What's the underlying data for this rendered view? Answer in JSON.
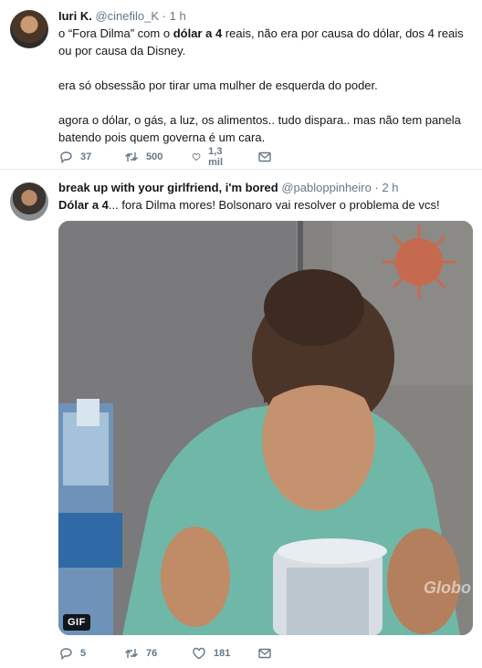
{
  "tweets": [
    {
      "name": "Iuri K.",
      "handle": "@cinefilo_K",
      "dot": "·",
      "time": "1 h",
      "lines": {
        "p1_a": "o “Fora Dilma” com o ",
        "p1_b": "dólar a 4",
        "p1_c": " reais, não era por causa do dólar, dos 4 reais ou por causa da Disney.",
        "p2": "era só obsessão por tirar uma mulher de esquerda do poder.",
        "p3": "agora o dólar, o gás, a luz, os alimentos.. tudo dispara.. mas não tem panela batendo pois quem governa é um cara."
      },
      "replies": "37",
      "retweets": "500",
      "likes": "1,3 mil"
    },
    {
      "name": "break up with your girlfriend, i'm bored",
      "handle": "@pabloppinheiro",
      "dot": "·",
      "time": "2 h",
      "lines": {
        "p1_a": "Dólar a 4",
        "p1_b": "... fora Dilma mores! Bolsonaro vai resolver o problema de vcs!"
      },
      "media": {
        "badge": "GIF",
        "watermark": "Globo"
      },
      "replies": "5",
      "retweets": "76",
      "likes": "181"
    }
  ],
  "icons": {
    "reply": "reply-icon",
    "retweet": "retweet-icon",
    "like": "heart-icon",
    "dm": "envelope-icon"
  },
  "colors": {
    "icon": "#657786",
    "text": "#14171a",
    "secondary": "#657786",
    "divider": "#e6ecf0"
  }
}
